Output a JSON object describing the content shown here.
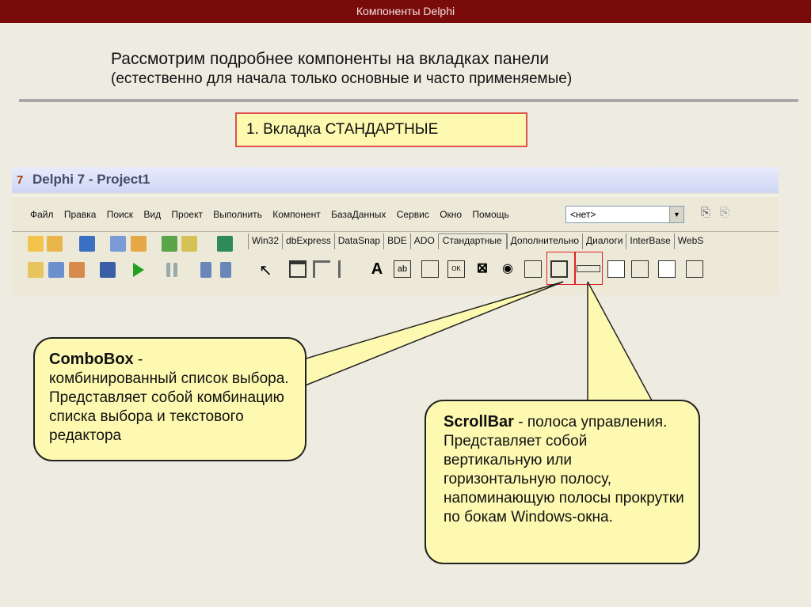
{
  "header": {
    "title": "Компоненты Delphi"
  },
  "heading": {
    "line1": "Рассмотрим подробнее компоненты на вкладках панели",
    "line2": "(естественно для начала только основные и часто применяемые)"
  },
  "tab_label": "1. Вкладка СТАНДАРТНЫЕ",
  "delphi": {
    "window_title": "Delphi 7 - Project1",
    "menu": [
      "Файл",
      "Правка",
      "Поиск",
      "Вид",
      "Проект",
      "Выполнить",
      "Компонент",
      "БазаДанных",
      "Сервис",
      "Окно",
      "Помощь"
    ],
    "combo_value": "<нет>",
    "palette_tabs": [
      "Win32",
      "dbExpress",
      "DataSnap",
      "BDE",
      "ADO",
      "Стандартные",
      "Дополнительно",
      "Диалоги",
      "InterBase",
      "WebS"
    ]
  },
  "callout_combobox": {
    "title": "ComboBox",
    "dash": " -",
    "text": "комбинированный список выбора. Представляет собой комбинацию списка выбора и текстового редактора"
  },
  "callout_scrollbar": {
    "title": "ScrollBar",
    "text": " - полоса управления. Представляет собой вертикальную или горизонтальную полосу, напоминающую полосы прокрутки по бокам Windows-окна."
  },
  "colors": {
    "accent": "#7a0b0b",
    "callout": "#fef9b0",
    "highlight": "#e02020"
  }
}
